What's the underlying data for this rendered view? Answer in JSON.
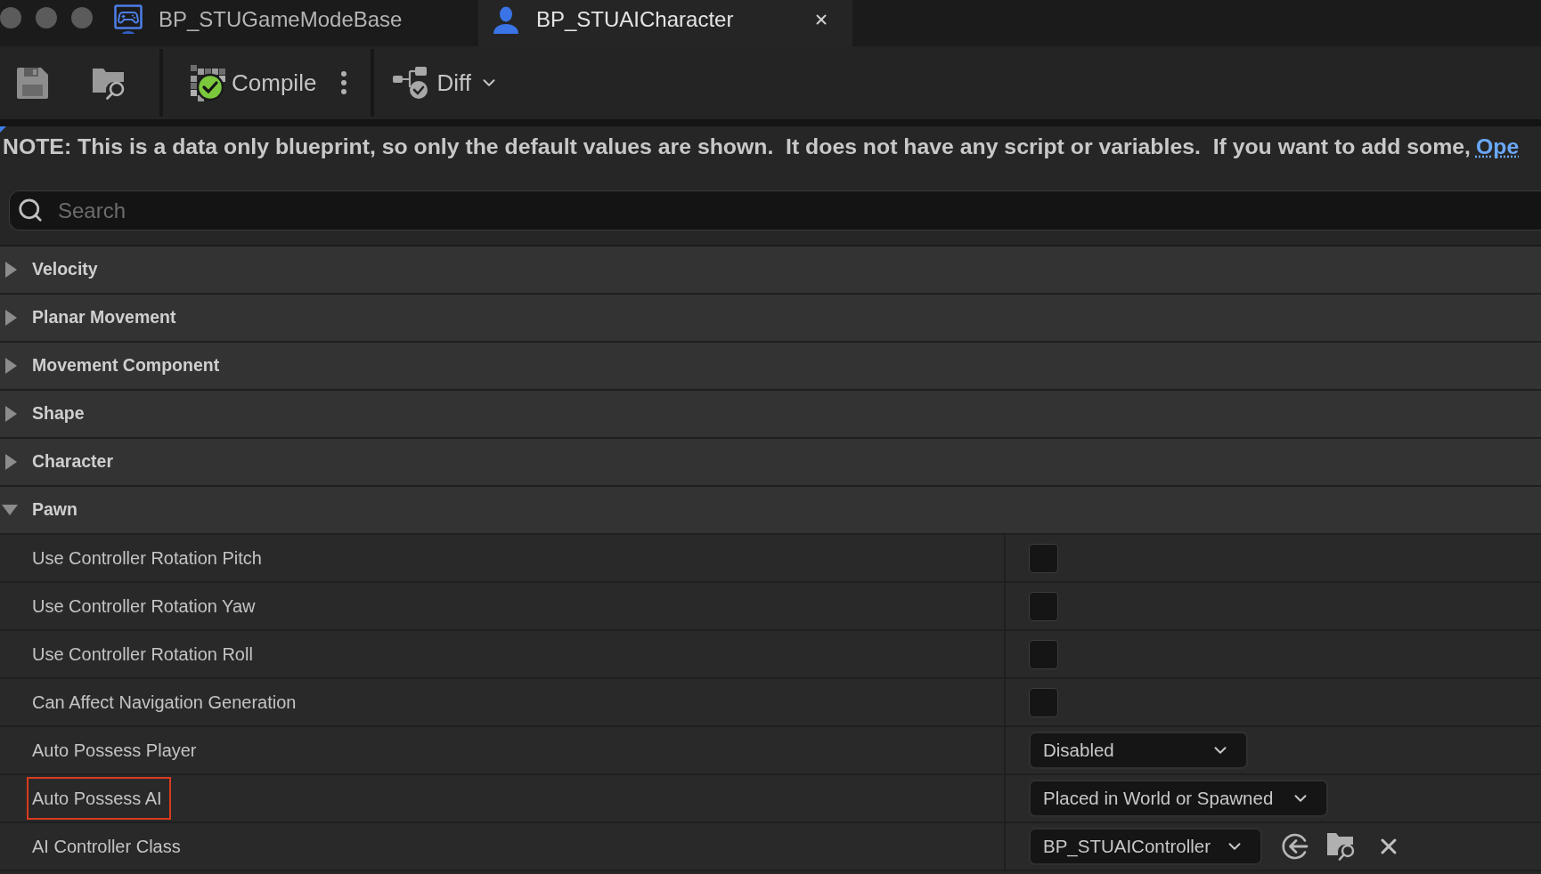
{
  "tabs": [
    {
      "label": "BP_STUGameModeBase",
      "kind": "game-mode",
      "selected": false
    },
    {
      "label": "BP_STUAICharacter",
      "kind": "character",
      "selected": true
    }
  ],
  "toolbar": [
    {
      "kind": "save"
    },
    {
      "kind": "browse"
    },
    {
      "kind": "separator"
    },
    {
      "kind": "compile",
      "label": "Compile"
    },
    {
      "kind": "more"
    },
    {
      "kind": "separator"
    },
    {
      "kind": "diff",
      "label": "Diff"
    }
  ],
  "note": {
    "text": "NOTE: This is a data only blueprint, so only the default values are shown.  It does not have any script or variables.  If you want to add some,",
    "link": "Ope"
  },
  "search": {
    "placeholder": "Search"
  },
  "categories": [
    {
      "title": "Velocity",
      "expanded": false
    },
    {
      "title": "Planar Movement",
      "expanded": false
    },
    {
      "title": "Movement Component",
      "expanded": false
    },
    {
      "title": "Shape",
      "expanded": false
    },
    {
      "title": "Character",
      "expanded": false
    },
    {
      "title": "Pawn",
      "expanded": true,
      "properties": [
        {
          "label": "Use Controller Rotation Pitch",
          "kind": "checkbox",
          "checked": false,
          "highlighted": false
        },
        {
          "label": "Use Controller Rotation Yaw",
          "kind": "checkbox",
          "checked": false,
          "highlighted": false
        },
        {
          "label": "Use Controller Rotation Roll",
          "kind": "checkbox",
          "checked": false,
          "highlighted": false
        },
        {
          "label": "Can Affect Navigation Generation",
          "kind": "checkbox",
          "checked": false,
          "highlighted": false
        },
        {
          "label": "Auto Possess Player",
          "kind": "dropdown",
          "value": "Disabled",
          "highlighted": false
        },
        {
          "label": "Auto Possess AI",
          "kind": "dropdown",
          "value": "Placed in World or Spawned",
          "highlighted": true
        },
        {
          "label": "AI Controller Class",
          "kind": "class",
          "value": "BP_STUAIController",
          "highlighted": false
        }
      ]
    }
  ]
}
